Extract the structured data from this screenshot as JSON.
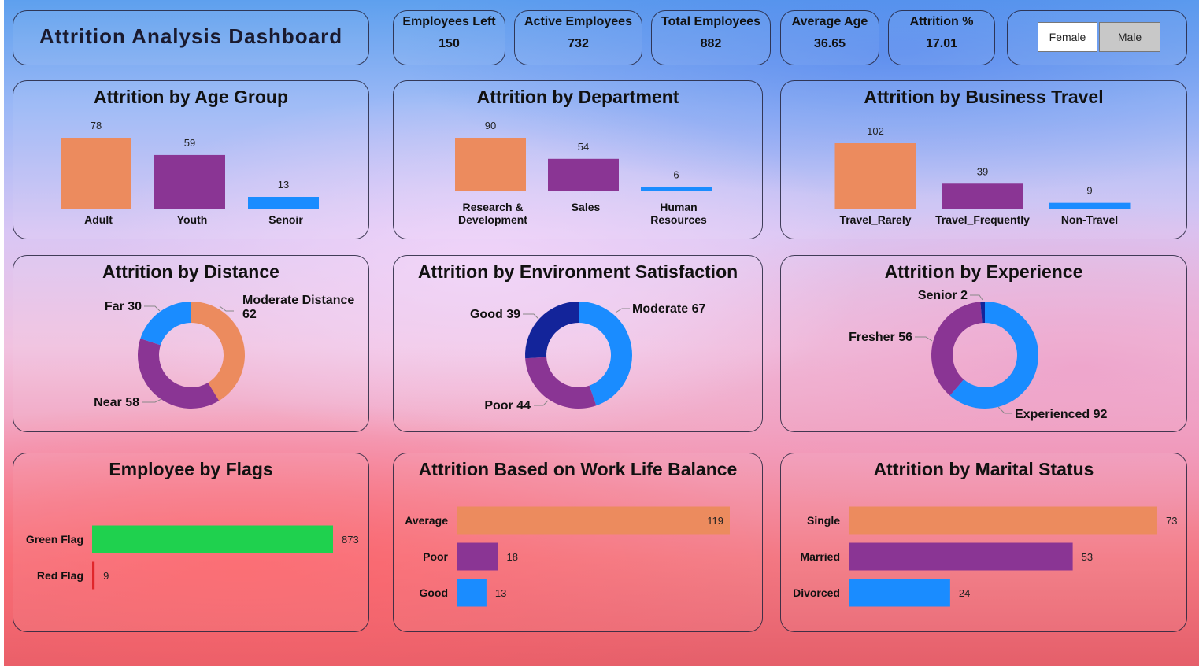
{
  "header": {
    "title": "Attrition Analysis Dashboard"
  },
  "kpis": [
    {
      "label": "Employees Left",
      "value": "150"
    },
    {
      "label": "Active Employees",
      "value": "732"
    },
    {
      "label": "Total Employees",
      "value": "882"
    },
    {
      "label": "Average Age",
      "value": "36.65"
    },
    {
      "label": "Attrition %",
      "value": "17.01"
    }
  ],
  "gender_filter": {
    "female_label": "Female",
    "male_label": "Male",
    "selected": "Male"
  },
  "colors": {
    "orange": "#ec8b5e",
    "purple": "#8a3594",
    "blue": "#1a8cff",
    "navy": "#13249a",
    "green": "#1fd14e",
    "red": "#e0262a"
  },
  "chart_data": [
    {
      "id": "age",
      "type": "bar",
      "title": "Attrition by Age Group",
      "categories": [
        "Adult",
        "Youth",
        "Senoir"
      ],
      "values": [
        78,
        59,
        13
      ],
      "ylim": [
        0,
        78
      ]
    },
    {
      "id": "dept",
      "type": "bar",
      "title": "Attrition by Department",
      "categories": [
        "Research & Development",
        "Sales",
        "Human Resources"
      ],
      "values": [
        90,
        54,
        6
      ],
      "ylim": [
        0,
        90
      ]
    },
    {
      "id": "travel",
      "type": "bar",
      "title": "Attrition by Business Travel",
      "categories": [
        "Travel_Rarely",
        "Travel_Frequently",
        "Non-Travel"
      ],
      "values": [
        102,
        39,
        9
      ],
      "ylim": [
        0,
        102
      ]
    },
    {
      "id": "distance",
      "type": "pie",
      "title": "Attrition by Distance",
      "labels": [
        "Moderate Distance",
        "Near",
        "Far"
      ],
      "values": [
        62,
        58,
        30
      ]
    },
    {
      "id": "environment",
      "type": "pie",
      "title": "Attrition by Environment Satisfaction",
      "labels": [
        "Moderate",
        "Poor",
        "Good"
      ],
      "values": [
        67,
        44,
        39
      ]
    },
    {
      "id": "experience",
      "type": "pie",
      "title": "Attrition by Experience",
      "labels": [
        "Experienced",
        "Fresher",
        "Senior"
      ],
      "values": [
        92,
        56,
        2
      ]
    },
    {
      "id": "flags",
      "type": "bar",
      "orientation": "horizontal",
      "title": "Employee by Flags",
      "categories": [
        "Green Flag",
        "Red Flag"
      ],
      "values": [
        873,
        9
      ],
      "xlim": [
        0,
        873
      ]
    },
    {
      "id": "worklife",
      "type": "bar",
      "orientation": "horizontal",
      "title": "Attrition Based on Work Life Balance",
      "categories": [
        "Average",
        "Poor",
        "Good"
      ],
      "values": [
        119,
        18,
        13
      ],
      "xlim": [
        0,
        119
      ]
    },
    {
      "id": "marital",
      "type": "bar",
      "orientation": "horizontal",
      "title": "Attrition by Marital Status",
      "categories": [
        "Single",
        "Married",
        "Divorced"
      ],
      "values": [
        73,
        53,
        24
      ],
      "xlim": [
        0,
        73
      ]
    }
  ]
}
